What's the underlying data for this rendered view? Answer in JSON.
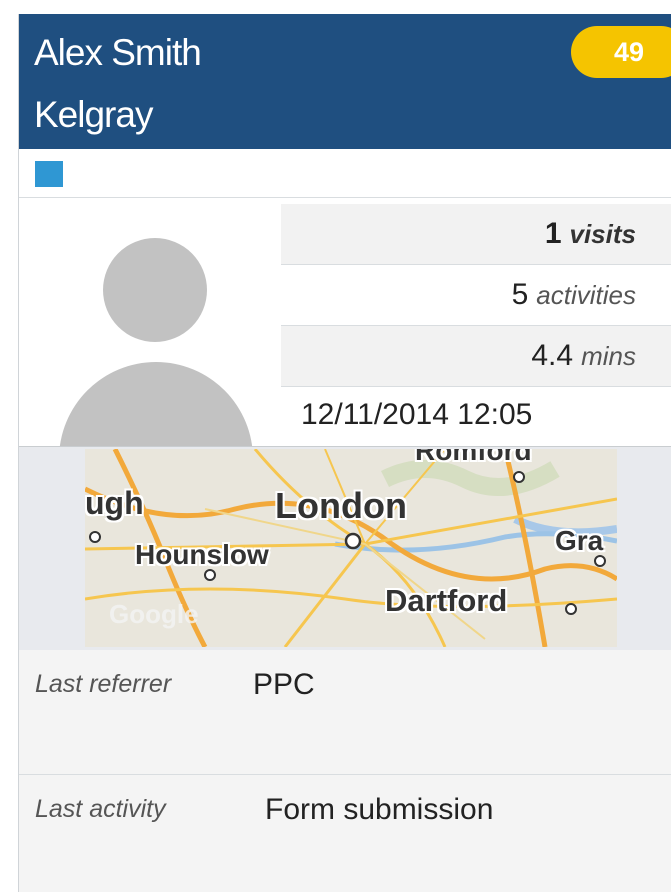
{
  "contact": {
    "name": "Alex Smith",
    "company": "Kelgray",
    "score": "49",
    "tag_color": "#2f97d3"
  },
  "stats": {
    "visits": {
      "value": "1",
      "unit": "visits"
    },
    "activities": {
      "value": "5",
      "unit": "activities"
    },
    "duration": {
      "value": "4.4",
      "unit": "mins"
    },
    "last_seen": "12/11/2014 12:05"
  },
  "map": {
    "labels": {
      "top": "Romford",
      "left_cut": "ugh",
      "city": "London",
      "west": "Hounslow",
      "east_cut": "Gra",
      "southeast": "Dartford"
    },
    "watermark": "Google"
  },
  "details": {
    "referrer_label": "Last referrer",
    "referrer_value": "PPC",
    "activity_label": "Last activity",
    "activity_value": "Form submission"
  },
  "colors": {
    "header_bg": "#1f4f80",
    "score_badge": "#f5c400"
  }
}
